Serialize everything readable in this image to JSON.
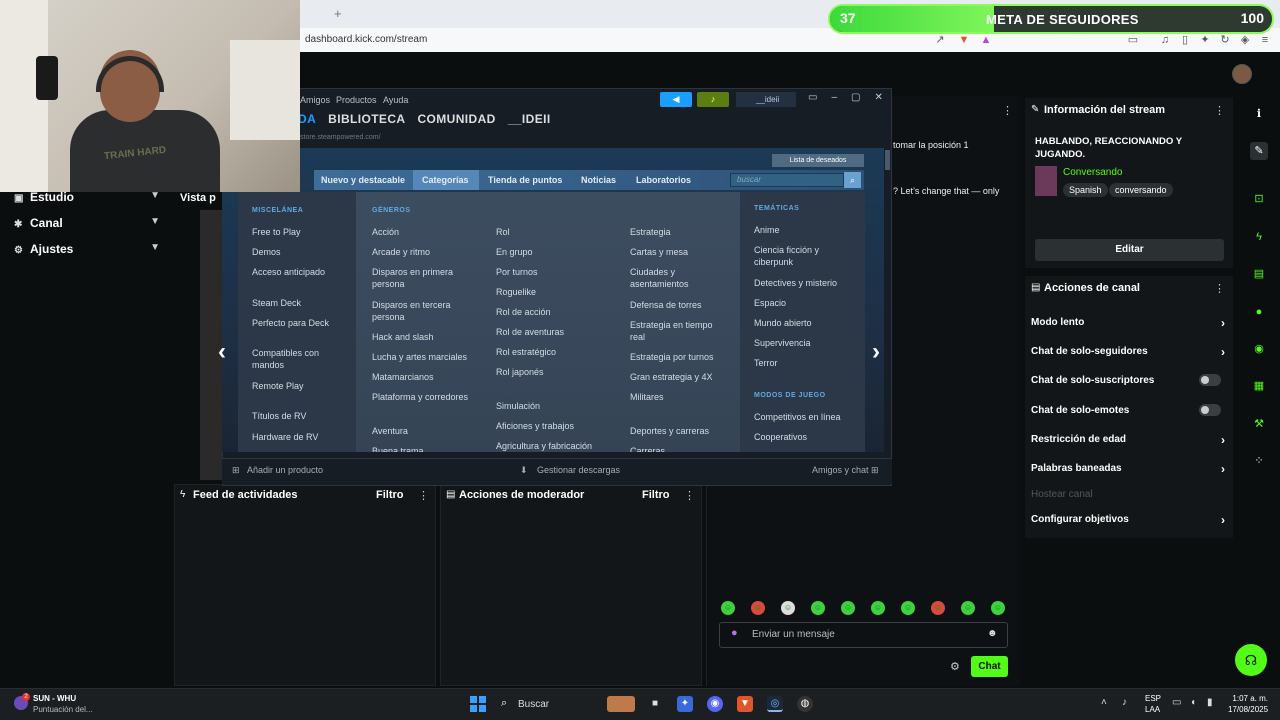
{
  "browser": {
    "url": "dashboard.kick.com/stream",
    "new_tab": "+"
  },
  "goal": {
    "current": "37",
    "title": "META DE SEGUIDORES",
    "target": "100",
    "progress": 0.37
  },
  "left_nav": {
    "items": [
      {
        "label": "Estudio"
      },
      {
        "label": "Canal"
      },
      {
        "label": "Ajustes"
      }
    ]
  },
  "preview": {
    "label": "Vista p"
  },
  "chat": {
    "messages": [
      "tomar la posición 1",
      "? Let’s change that — only"
    ],
    "input_placeholder": "Enviar un mensaje",
    "send_label": "Chat"
  },
  "stream_info": {
    "title": "Información del stream",
    "stream_title": "HABLANDO, REACCIONANDO Y JUGANDO.",
    "category": "Conversando",
    "tags": [
      "Spanish",
      "conversando"
    ],
    "edit_label": "Editar"
  },
  "channel_actions": {
    "title": "Acciones de canal",
    "rows": [
      {
        "label": "Modo lento",
        "control": "chevron"
      },
      {
        "label": "Chat de solo-seguidores",
        "control": "chevron"
      },
      {
        "label": "Chat de solo-suscriptores",
        "control": "toggle"
      },
      {
        "label": "Chat de solo-emotes",
        "control": "toggle"
      },
      {
        "label": "Restricción de edad",
        "control": "chevron"
      },
      {
        "label": "Palabras baneadas",
        "control": "chevron"
      },
      {
        "label": "Hostear canal",
        "control": "none"
      },
      {
        "label": "Configurar objetivos",
        "control": "chevron"
      }
    ]
  },
  "bottom_panels": {
    "feed": {
      "title": "Feed de actividades",
      "filter": "Filtro"
    },
    "mod": {
      "title": "Acciones de moderador",
      "filter": "Filtro"
    }
  },
  "steam": {
    "menu": [
      "Amigos",
      "Productos",
      "Ayuda"
    ],
    "nav": [
      "DA",
      "BIBLIOTECA",
      "COMUNIDAD",
      "__IDEII"
    ],
    "url": "store.steampowered.com/",
    "user": "__ideii",
    "wishlist": "Lista de deseados",
    "store_nav": [
      "Nuevo y destacable",
      "Categorías",
      "Tienda de puntos",
      "Noticias",
      "Laboratorios"
    ],
    "search_placeholder": "buscar",
    "col1": {
      "head": "MISCELÁNEA",
      "items": [
        "Free to Play",
        "Demos",
        "Acceso anticipado",
        "Steam Deck",
        "Perfecto para Deck",
        "Compatibles con mandos",
        "Remote Play",
        "Títulos de RV",
        "Hardware de RV"
      ]
    },
    "col2": {
      "head": "GÉNEROS",
      "items": [
        "Acción",
        "Arcade y ritmo",
        "Disparos en primera persona",
        "Disparos en tercera persona",
        "Hack and slash",
        "Lucha y artes marciales",
        "Matamarcianos",
        "Plataforma y corredores",
        "Aventura",
        "Buena trama"
      ]
    },
    "col3": {
      "items": [
        "Rol",
        "En grupo",
        "Por turnos",
        "Roguelike",
        "Rol de acción",
        "Rol de aventuras",
        "Rol estratégico",
        "Rol japonés",
        "Simulación",
        "Aficiones y trabajos",
        "Agricultura y fabricación"
      ]
    },
    "col4": {
      "items": [
        "Estrategia",
        "Cartas y mesa",
        "Ciudades y asentamientos",
        "Defensa de torres",
        "Estrategia en tiempo real",
        "Estrategia por turnos",
        "Gran estrategia y 4X",
        "Militares",
        "Deportes y carreras",
        "Carreras"
      ]
    },
    "col5": {
      "head": "TEMÁTICAS",
      "items": [
        "Anime",
        "Ciencia ficción y ciberpunk",
        "Detectives y misterio",
        "Espacio",
        "Mundo abierto",
        "Supervivencia",
        "Terror"
      ],
      "head2": "MODOS DE JUEGO",
      "items2": [
        "Competitivos en línea",
        "Cooperativos"
      ]
    },
    "bottom": {
      "add_product": "Añadir un producto",
      "downloads": "Gestionar descargas",
      "friends": "Amigos y chat"
    }
  },
  "webcam": {
    "shirt_text": "TRAIN HARD"
  },
  "taskbar": {
    "weather_title": "SUN - WHU",
    "weather_sub": "Puntuación del...",
    "weather_badge": "2",
    "search": "Buscar",
    "lang1": "ESP",
    "lang2": "LAA",
    "time": "1:07 a. m.",
    "date": "17/08/2025"
  }
}
